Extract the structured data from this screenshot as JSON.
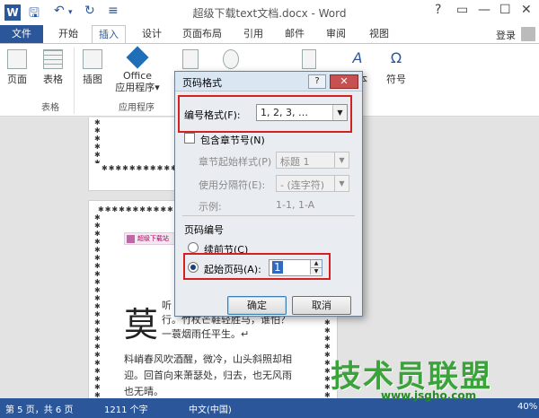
{
  "window": {
    "title": "超级下载text文档.docx - Word",
    "app_icon": "W",
    "qa_save": "🖫",
    "qa_undo": "↶",
    "qa_undo_menu": "▾",
    "qa_redo": "↻",
    "qa_customize": "≡",
    "help": "?",
    "btn_restore": "▭",
    "btn_minimize": "—",
    "btn_maximize": "☐",
    "btn_close": "✕"
  },
  "tabs": [
    "文件",
    "开始",
    "插入",
    "设计",
    "页面布局",
    "引用",
    "邮件",
    "审阅",
    "视图"
  ],
  "active_tab": "插入",
  "login": "登录",
  "ribbon": {
    "buttons": [
      "页面",
      "表格",
      "插图",
      "Office",
      "应用程序▾",
      "文本",
      "符号"
    ],
    "groups": [
      "表格",
      "应用程序"
    ]
  },
  "document": {
    "header_badge": "超级下载站",
    "big_char": "莫",
    "lines": [
      "听",
      "行。竹杖芒鞋轻胜马，谁怕？",
      "一蓑烟雨任平生。↵",
      "料峭春风吹酒醒，微冷，山头斜照却相",
      "迎。回首向来萧瑟处，归去，也无风雨",
      "也无晴。"
    ]
  },
  "dialog": {
    "title": "页码格式",
    "help": "?",
    "close": "✕",
    "number_format_label": "编号格式(F):",
    "number_format_value": "1, 2, 3, …",
    "include_chapter_label": "包含章节号(N)",
    "chapter_style_label": "章节起始样式(P)",
    "chapter_style_value": "标题 1",
    "separator_label": "使用分隔符(E):",
    "separator_value": "-  (连字符)",
    "example_label": "示例:",
    "example_value": "1-1, 1-A",
    "page_numbering_section": "页码编号",
    "continue_label": "续前节(C)",
    "start_at_label": "起始页码(A):",
    "start_at_value": "1",
    "ok": "确定",
    "cancel": "取消"
  },
  "status": {
    "page": "第 5 页，共 6 页",
    "words": "1211 个字",
    "language": "中文(中国)",
    "zoom": "40%"
  },
  "watermark": {
    "text": "技术员联盟",
    "url": "www.jsgho.com"
  }
}
